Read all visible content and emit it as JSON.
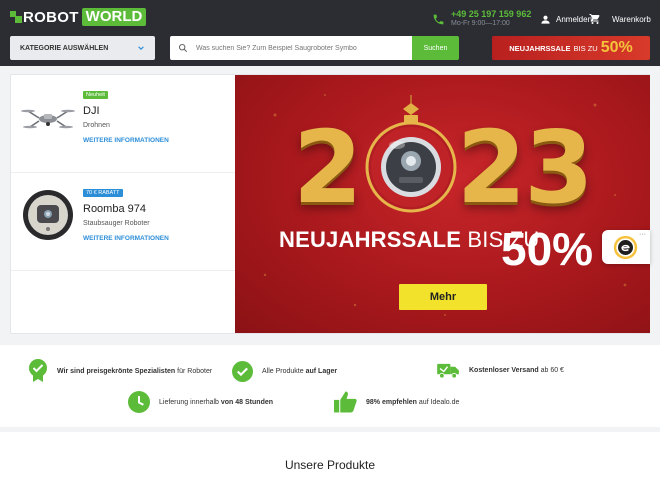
{
  "header": {
    "logo_robot": "ROBOT",
    "logo_world": "WORLD",
    "phone": "+49 25 197 159 962",
    "hours": "Mo-Fr 9:00—17:00",
    "login": "Anmelden",
    "cart": "Warenkorb",
    "category_label": "KATEGORIE AUSWÄHLEN",
    "search_placeholder": "Was suchen Sie? Zum Beispiel Saugroboter Symbo",
    "search_button": "Suchen",
    "sale_banner": {
      "bold": "NEUJAHRSSALE",
      "thin": "BIS ZU",
      "pct": "50%"
    }
  },
  "products_side": [
    {
      "badge": "Neuheit",
      "name": "DJI",
      "category": "Drohnen",
      "more": "WEITERE INFORMATIONEN"
    },
    {
      "badge": "70 € RABATT",
      "name": "Roomba 974",
      "category": "Staubsauger Roboter",
      "more": "WEITERE INFORMATIONEN"
    }
  ],
  "hero": {
    "year_left": "2",
    "year_right": "23",
    "title_bold": "NEUJAHRSSALE",
    "title_thin": "BIS ZU",
    "pct": "50%",
    "button": "Mehr"
  },
  "usp": {
    "item1_bold": "Wir sind preisgekrönte Spezialisten",
    "item1_rest": " für Roboter",
    "item2_rest": "Alle Produkte ",
    "item2_bold": "auf Lager",
    "item3_bold": "Kostenloser Versand",
    "item3_rest": " ab 60 €",
    "item4_rest": "Lieferung innerhalb ",
    "item4_bold": "von 48 Stunden",
    "item5_bold": "98% empfehlen",
    "item5_rest": " auf Idealo.de"
  },
  "section_title": "Unsere Produkte",
  "colors": {
    "accent_green": "#5cbc3a",
    "header_bg": "#2b2d33",
    "link_blue": "#2d8ed8",
    "sale_red": "#c8262a",
    "gold": "#e7b64b"
  }
}
